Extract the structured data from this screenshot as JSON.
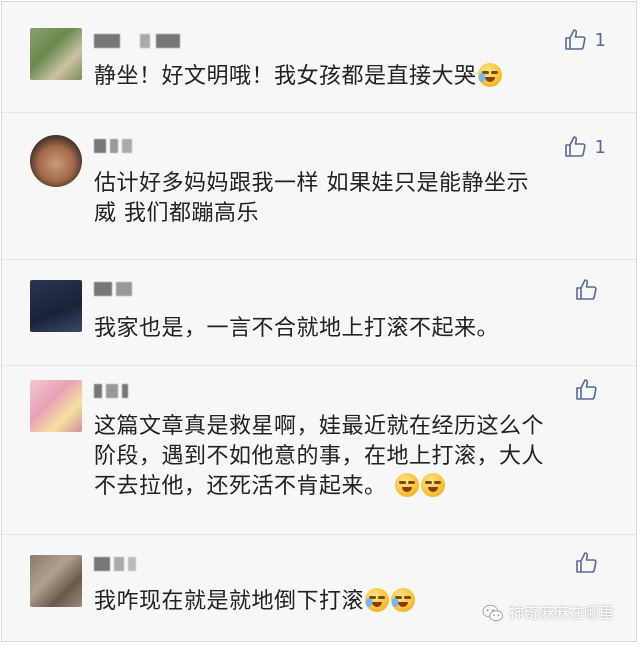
{
  "comments": [
    {
      "id": "c1",
      "text_lines": [
        "静坐！好文明哦！我女孩都是直接大哭"
      ],
      "emoji_after": [
        "cry-laugh-emoji"
      ],
      "likes": "1"
    },
    {
      "id": "c2",
      "text_lines": [
        "估计好多妈妈跟我一样 如果娃只是能静坐示",
        "威 我们都蹦高乐"
      ],
      "emoji_after": [],
      "likes": "1"
    },
    {
      "id": "c3",
      "text_lines": [
        "我家也是，一言不合就地上打滚不起来。"
      ],
      "emoji_after": [],
      "likes": ""
    },
    {
      "id": "c4",
      "text_lines": [
        "这篇文章真是救星啊，娃最近就在经历这么个",
        "阶段，遇到不如他意的事，在地上打滚，大人",
        "不去拉他，还死活不肯起来。"
      ],
      "emoji_after": [
        "smirk-emoji",
        "smirk-emoji"
      ],
      "likes": ""
    },
    {
      "id": "c5",
      "text_lines": [
        "我咋现在就是就地倒下打滚"
      ],
      "emoji_after": [
        "cry-laugh-emoji",
        "cry-laugh-emoji"
      ],
      "likes": ""
    }
  ],
  "watermark": {
    "text": "神奇麻麻在哪里",
    "icon": "wechat-icon"
  },
  "colors": {
    "background": "#f7f7f7",
    "text": "#222222",
    "like": "#576b95",
    "separator": "#e6e6e6"
  }
}
